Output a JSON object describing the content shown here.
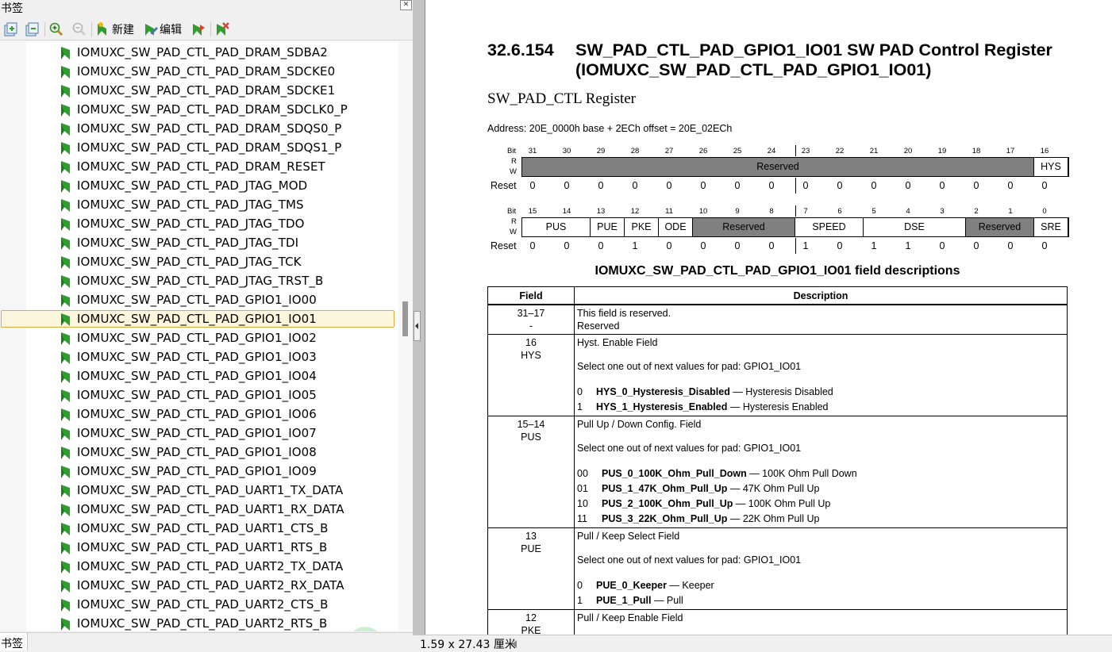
{
  "bookmarks_pane": {
    "title": "书签",
    "close_glyph": "✕",
    "toolbar": {
      "new_label": "新建",
      "edit_label": "编辑"
    },
    "items": [
      "IOMUXC_SW_PAD_CTL_PAD_DRAM_SDBA2",
      "IOMUXC_SW_PAD_CTL_PAD_DRAM_SDCKE0",
      "IOMUXC_SW_PAD_CTL_PAD_DRAM_SDCKE1",
      "IOMUXC_SW_PAD_CTL_PAD_DRAM_SDCLK0_P",
      "IOMUXC_SW_PAD_CTL_PAD_DRAM_SDQS0_P",
      "IOMUXC_SW_PAD_CTL_PAD_DRAM_SDQS1_P",
      "IOMUXC_SW_PAD_CTL_PAD_DRAM_RESET",
      "IOMUXC_SW_PAD_CTL_PAD_JTAG_MOD",
      "IOMUXC_SW_PAD_CTL_PAD_JTAG_TMS",
      "IOMUXC_SW_PAD_CTL_PAD_JTAG_TDO",
      "IOMUXC_SW_PAD_CTL_PAD_JTAG_TDI",
      "IOMUXC_SW_PAD_CTL_PAD_JTAG_TCK",
      "IOMUXC_SW_PAD_CTL_PAD_JTAG_TRST_B",
      "IOMUXC_SW_PAD_CTL_PAD_GPIO1_IO00",
      "IOMUXC_SW_PAD_CTL_PAD_GPIO1_IO01",
      "IOMUXC_SW_PAD_CTL_PAD_GPIO1_IO02",
      "IOMUXC_SW_PAD_CTL_PAD_GPIO1_IO03",
      "IOMUXC_SW_PAD_CTL_PAD_GPIO1_IO04",
      "IOMUXC_SW_PAD_CTL_PAD_GPIO1_IO05",
      "IOMUXC_SW_PAD_CTL_PAD_GPIO1_IO06",
      "IOMUXC_SW_PAD_CTL_PAD_GPIO1_IO07",
      "IOMUXC_SW_PAD_CTL_PAD_GPIO1_IO08",
      "IOMUXC_SW_PAD_CTL_PAD_GPIO1_IO09",
      "IOMUXC_SW_PAD_CTL_PAD_UART1_TX_DATA",
      "IOMUXC_SW_PAD_CTL_PAD_UART1_RX_DATA",
      "IOMUXC_SW_PAD_CTL_PAD_UART1_CTS_B",
      "IOMUXC_SW_PAD_CTL_PAD_UART1_RTS_B",
      "IOMUXC_SW_PAD_CTL_PAD_UART2_TX_DATA",
      "IOMUXC_SW_PAD_CTL_PAD_UART2_RX_DATA",
      "IOMUXC_SW_PAD_CTL_PAD_UART2_CTS_B",
      "IOMUXC_SW_PAD_CTL_PAD_UART2_RTS_B"
    ],
    "selected_item": "IOMUXC_SW_PAD_CTL_PAD_GPIO1_IO01",
    "bottom_tab": "书签",
    "bookmark_icon_color": "#2f9e2f",
    "selection_border_color": "#e2a940"
  },
  "document": {
    "section_number": "32.6.154",
    "section_title": "SW_PAD_CTL_PAD_GPIO1_IO01 SW PAD Control Register (IOMUXC_SW_PAD_CTL_PAD_GPIO1_IO01)",
    "register_name": "SW_PAD_CTL Register",
    "address": "Address: 20E_0000h base + 2ECh offset = 20E_02ECh",
    "register_tables": [
      {
        "bit_label": "Bit",
        "r_label": "R",
        "w_label": "W",
        "reset_label": "Reset",
        "bits": [
          "31",
          "30",
          "29",
          "28",
          "27",
          "26",
          "25",
          "24",
          "23",
          "22",
          "21",
          "20",
          "19",
          "18",
          "17",
          "16"
        ],
        "fields": [
          {
            "name": "Reserved",
            "span": 15,
            "reserved": true
          },
          {
            "name": "HYS",
            "span": 1,
            "reserved": false
          }
        ],
        "resets": [
          "0",
          "0",
          "0",
          "0",
          "0",
          "0",
          "0",
          "0",
          "0",
          "0",
          "0",
          "0",
          "0",
          "0",
          "0",
          "0"
        ]
      },
      {
        "bit_label": "Bit",
        "r_label": "R",
        "w_label": "W",
        "reset_label": "Reset",
        "bits": [
          "15",
          "14",
          "13",
          "12",
          "11",
          "10",
          "9",
          "8",
          "7",
          "6",
          "5",
          "4",
          "3",
          "2",
          "1",
          "0"
        ],
        "fields": [
          {
            "name": "PUS",
            "span": 2,
            "reserved": false
          },
          {
            "name": "PUE",
            "span": 1,
            "reserved": false
          },
          {
            "name": "PKE",
            "span": 1,
            "reserved": false
          },
          {
            "name": "ODE",
            "span": 1,
            "reserved": false
          },
          {
            "name": "Reserved",
            "span": 3,
            "reserved": true
          },
          {
            "name": "SPEED",
            "span": 2,
            "reserved": false
          },
          {
            "name": "DSE",
            "span": 3,
            "reserved": false
          },
          {
            "name": "Reserved",
            "span": 2,
            "reserved": true
          },
          {
            "name": "SRE",
            "span": 1,
            "reserved": false
          }
        ],
        "resets": [
          "0",
          "0",
          "0",
          "1",
          "0",
          "0",
          "0",
          "0",
          "1",
          "0",
          "1",
          "1",
          "0",
          "0",
          "0",
          "0"
        ]
      }
    ],
    "table_caption": "IOMUXC_SW_PAD_CTL_PAD_GPIO1_IO01 field descriptions",
    "table_headers": {
      "field": "Field",
      "description": "Description"
    },
    "field_rows": [
      {
        "field": [
          "31–17",
          "-"
        ],
        "lines": [
          "This field is reserved.",
          "Reserved"
        ],
        "select_text": "",
        "values": []
      },
      {
        "field": [
          "16",
          "HYS"
        ],
        "lines": [
          "Hyst. Enable Field"
        ],
        "select_text": "Select one out of next values for pad: GPIO1_IO01",
        "values": [
          {
            "code": "0",
            "name": "HYS_0_Hysteresis_Disabled",
            "desc": " — Hysteresis Disabled"
          },
          {
            "code": "1",
            "name": "HYS_1_Hysteresis_Enabled",
            "desc": " — Hysteresis Enabled"
          }
        ]
      },
      {
        "field": [
          "15–14",
          "PUS"
        ],
        "lines": [
          "Pull Up / Down Config. Field"
        ],
        "select_text": "Select one out of next values for pad: GPIO1_IO01",
        "values": [
          {
            "code": "00",
            "name": "PUS_0_100K_Ohm_Pull_Down",
            "desc": " — 100K Ohm Pull Down"
          },
          {
            "code": "01",
            "name": "PUS_1_47K_Ohm_Pull_Up",
            "desc": " — 47K Ohm Pull Up"
          },
          {
            "code": "10",
            "name": "PUS_2_100K_Ohm_Pull_Up",
            "desc": " — 100K Ohm Pull Up"
          },
          {
            "code": "11",
            "name": "PUS_3_22K_Ohm_Pull_Up",
            "desc": " — 22K Ohm Pull Up"
          }
        ]
      },
      {
        "field": [
          "13",
          "PUE"
        ],
        "lines": [
          "Pull / Keep Select Field"
        ],
        "select_text": "Select one out of next values for pad: GPIO1_IO01",
        "values": [
          {
            "code": "0",
            "name": "PUE_0_Keeper",
            "desc": " — Keeper"
          },
          {
            "code": "1",
            "name": "PUE_1_Pull",
            "desc": " — Pull"
          }
        ]
      },
      {
        "field": [
          "12",
          "PKE"
        ],
        "lines": [
          "Pull / Keep Enable Field"
        ],
        "select_text": "",
        "values": []
      }
    ]
  },
  "status_bar": {
    "page_size": "1.59 x 27.43 厘米"
  }
}
